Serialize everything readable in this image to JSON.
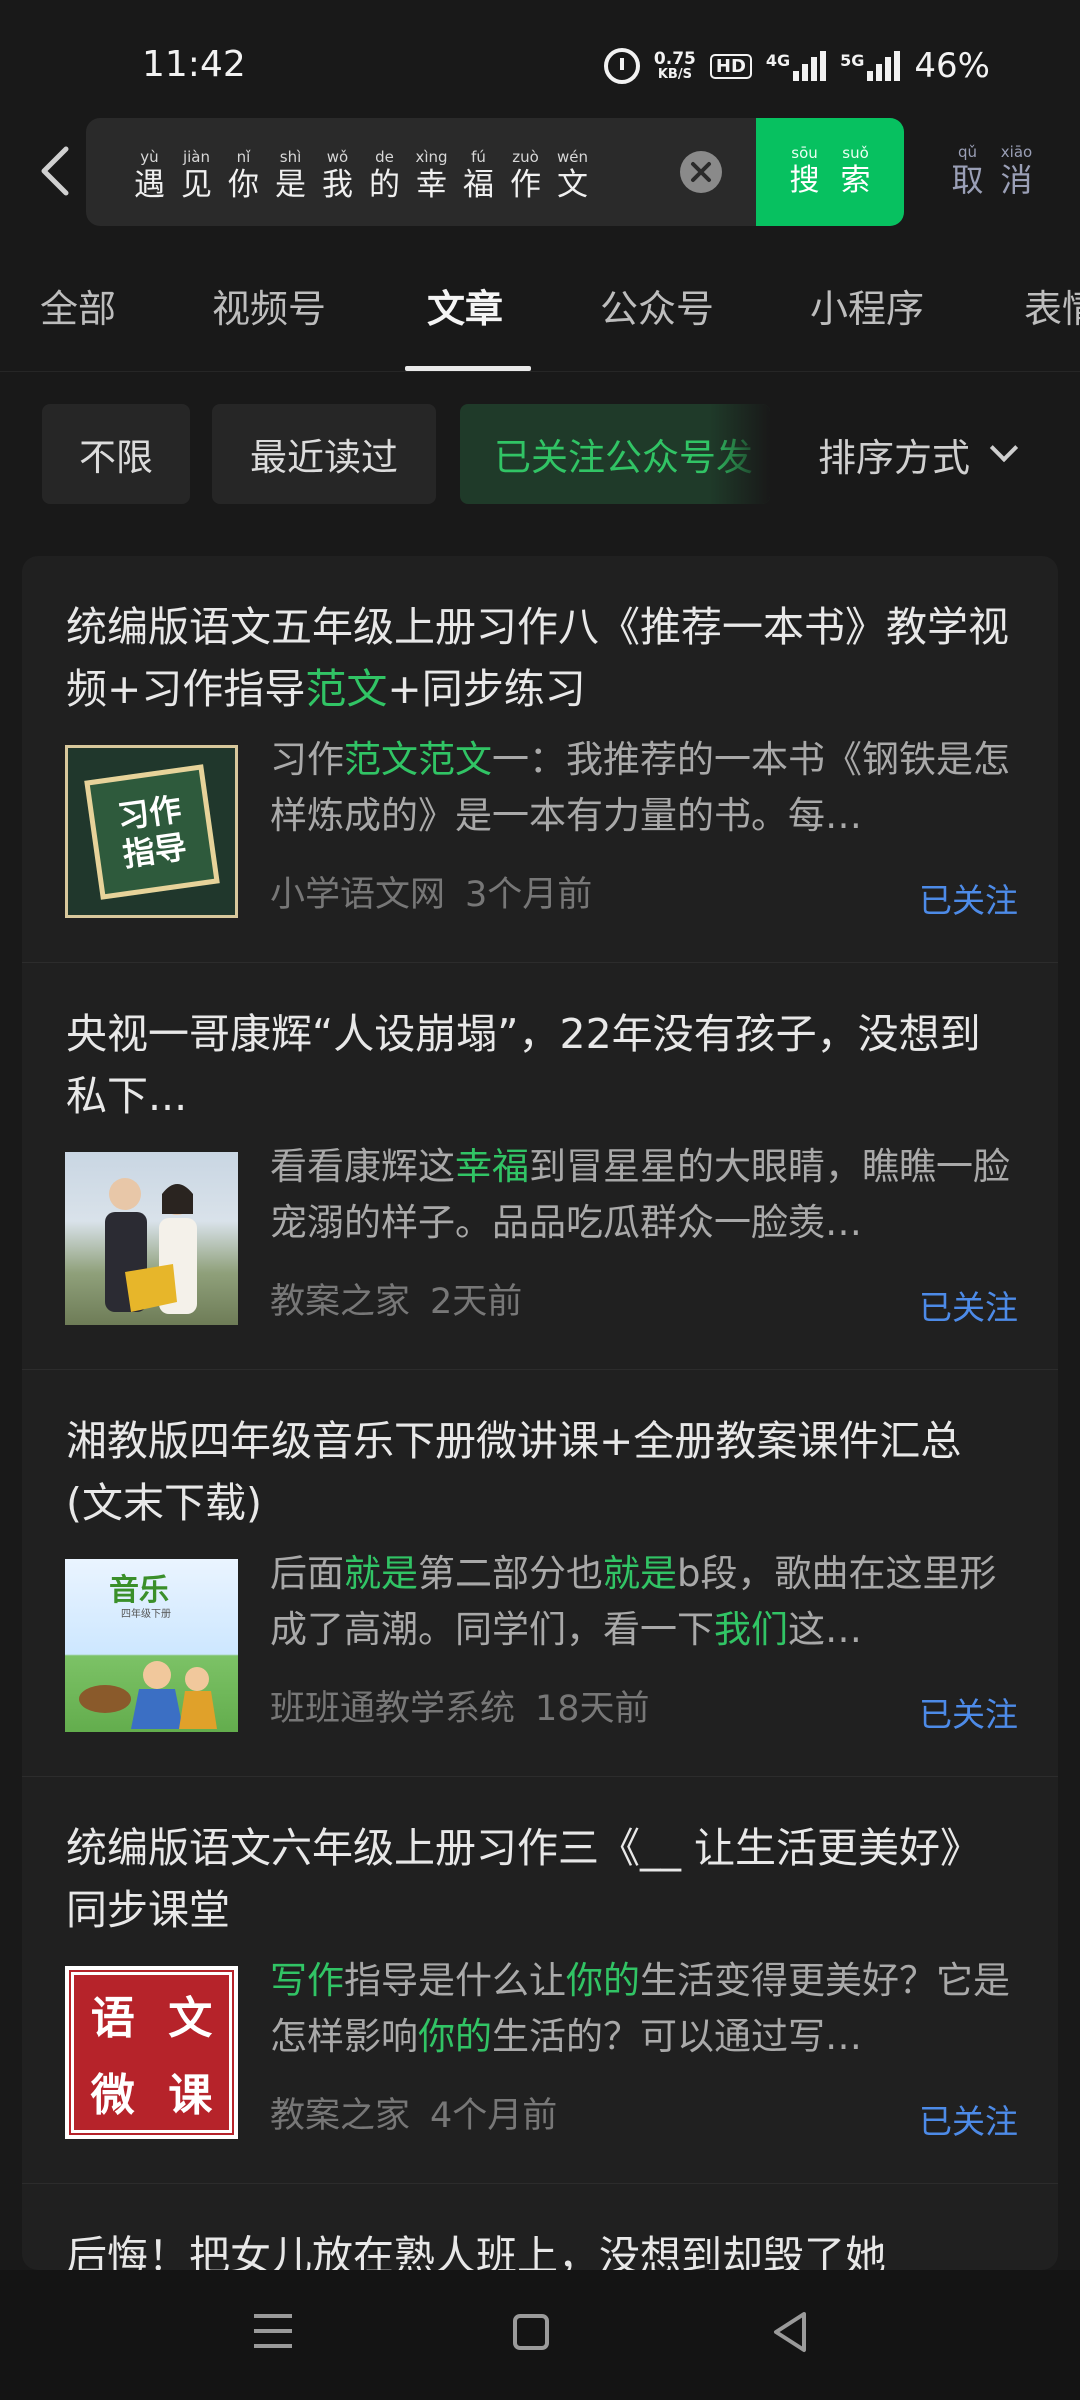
{
  "status_bar": {
    "time": "11:42",
    "net_speed_value": "0.75",
    "net_speed_unit": "KB/S",
    "hd_badge": "HD",
    "network_1": "4G",
    "network_2": "5G",
    "battery": "46%"
  },
  "search": {
    "query_chars": [
      "遇",
      "见",
      "你",
      "是",
      "我",
      "的",
      "幸",
      "福",
      "作",
      "文"
    ],
    "query_pinyin": [
      "yù",
      "jiàn",
      "nǐ",
      "shì",
      "wǒ",
      "de",
      "xìng",
      "fú",
      "zuò",
      "wén"
    ],
    "button_chars": [
      "搜",
      "索"
    ],
    "button_pinyin": [
      "sōu",
      "suǒ"
    ],
    "cancel_chars": [
      "取",
      "消"
    ],
    "cancel_pinyin": [
      "qǔ",
      "xiāo"
    ],
    "accent_color": "#07c160"
  },
  "tabs": [
    "全部",
    "视频号",
    "文章",
    "公众号",
    "小程序",
    "表情"
  ],
  "active_tab": "文章",
  "filters": {
    "chips": [
      "不限",
      "最近读过",
      "已关注公众号发"
    ],
    "sort_label": "排序方式"
  },
  "results": [
    {
      "title_pre": "统编版语文五年级上册习作八《推荐一本书》教学视频+习作指导",
      "title_hl": "范文",
      "title_post": "+同步练习",
      "thumb_text": [
        "习作",
        "指导"
      ],
      "snippet_pre": "习作",
      "snippet_hl1": "范文范文",
      "snippet_mid": "一：我推荐的一本书《钢铁是怎样炼成的》是一本有力量的书。每…",
      "snippet_hl2": "",
      "snippet_post": "",
      "source": "小学语文网",
      "time": "3个月前",
      "follow_label": "已关注"
    },
    {
      "title_pre": "央视一哥康辉“人设崩塌”，22年没有孩子，没想到私下...",
      "title_hl": "",
      "title_post": "",
      "snippet_pre": "看看康辉这",
      "snippet_hl1": "幸福",
      "snippet_mid": "到冒星星的大眼睛，瞧瞧一脸宠溺的样子。品品吃瓜群众一脸羡…",
      "snippet_hl2": "",
      "snippet_post": "",
      "source": "教案之家",
      "time": "2天前",
      "follow_label": "已关注"
    },
    {
      "title_pre": "湘教版四年级音乐下册微讲课+全册教案课件汇总(文末下载)",
      "title_hl": "",
      "title_post": "",
      "thumb_text": [
        "音乐",
        "四年级下册"
      ],
      "snippet_pre": "后面",
      "snippet_hl1": "就是",
      "snippet_mid": "第二部分也",
      "snippet_hl2": "就是",
      "snippet_post": "b段，歌曲在这里形成了高潮。同学们，看一下",
      "snippet_hl3": "我们",
      "snippet_end": "这…",
      "source": "班班通教学系统",
      "time": "18天前",
      "follow_label": "已关注"
    },
    {
      "title_pre": "统编版语文六年级上册习作三《__ 让生活更美好》同步课堂",
      "title_hl": "",
      "title_post": "",
      "thumb_text": [
        "语",
        "文",
        "微",
        "课"
      ],
      "snippet_pre": "",
      "snippet_hl1": "写作",
      "snippet_mid": "指导是什么让",
      "snippet_hl2": "你的",
      "snippet_post": "生活变得更美好？它是怎样影响",
      "snippet_hl3": "你的",
      "snippet_end": "生活的？可以通过写…",
      "source": "教案之家",
      "time": "4个月前",
      "follow_label": "已关注"
    }
  ],
  "partial_title": "后悔！把女儿放在熟人班上，没想到却毁了她",
  "nav_bar": {
    "icons": [
      "menu-icon",
      "home-icon",
      "back-icon"
    ]
  }
}
